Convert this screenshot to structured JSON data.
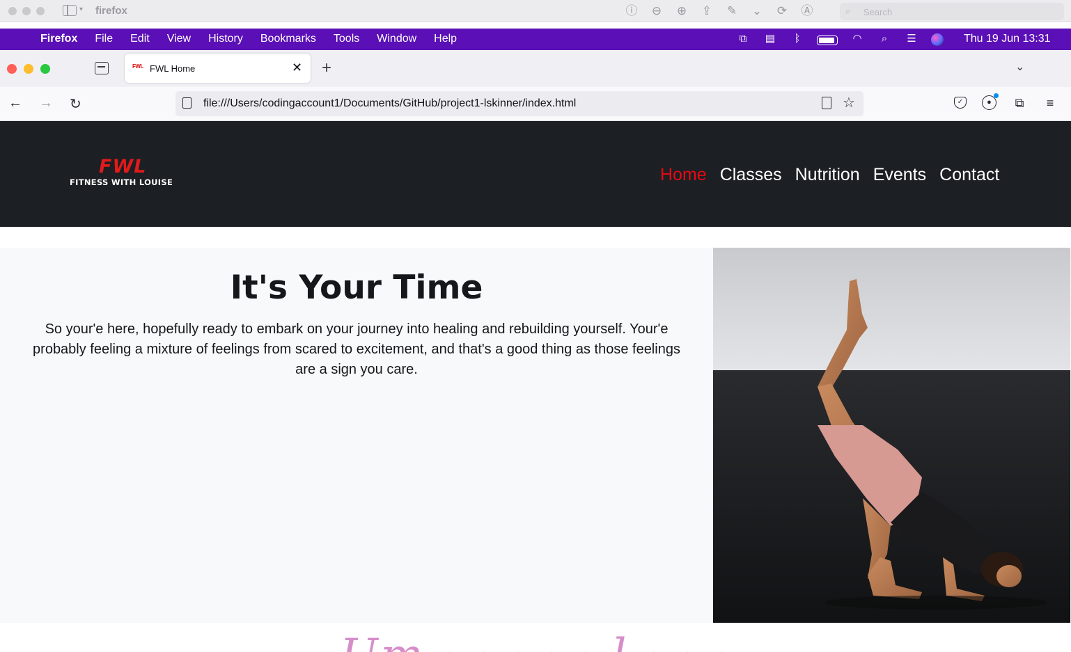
{
  "outer_window": {
    "app_title": "firefox",
    "search_placeholder": "Search"
  },
  "menubar": {
    "app_name": "Firefox",
    "menus": [
      "File",
      "Edit",
      "View",
      "History",
      "Bookmarks",
      "Tools",
      "Window",
      "Help"
    ],
    "clock": "Thu 19 Jun  13:31"
  },
  "browser": {
    "tab_title": "FWL Home",
    "tab_favicon_text": "FWL",
    "url": "file:///Users/codingaccount1/Documents/GitHub/project1-lskinner/index.html"
  },
  "site": {
    "logo_mark": "FWL",
    "logo_text": "FITNESS WITH LOUISE",
    "nav": [
      {
        "label": "Home",
        "active": true
      },
      {
        "label": "Classes",
        "active": false
      },
      {
        "label": "Nutrition",
        "active": false
      },
      {
        "label": "Events",
        "active": false
      },
      {
        "label": "Contact",
        "active": false
      }
    ],
    "hero": {
      "title": "It's Your Time",
      "text": "So your'e here, hopefully ready to embark on your journey into healing and rebuilding yourself. Your'e probably feeling a mixture of feelings from scared to excitement, and that's a good thing as those feelings are a sign you care."
    },
    "colors": {
      "header_bg": "#1c1f23",
      "nav_active": "#e50914",
      "hero_bg": "#f8f9fa",
      "menubar_bg": "#5b0fb6"
    }
  }
}
